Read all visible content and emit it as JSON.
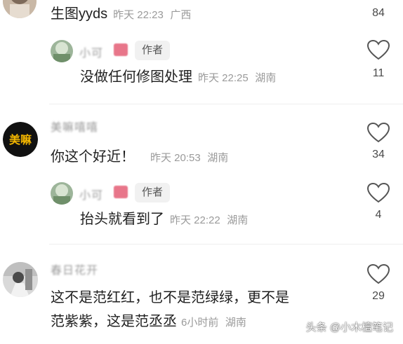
{
  "comments": [
    {
      "text": "生图yyds",
      "time": "昨天 22:23",
      "location": "广西",
      "likes": "84"
    },
    {
      "author_name": "小可",
      "badge": "作者",
      "text": "没做任何修图处理",
      "time": "昨天 22:25",
      "location": "湖南",
      "likes": "11"
    },
    {
      "author_name": "美嘛嘻嘻",
      "avatar_text": "美嘛",
      "text": "你这个好近！",
      "time": "昨天 20:53",
      "location": "湖南",
      "likes": "34"
    },
    {
      "author_name": "小可",
      "badge": "作者",
      "text": "抬头就看到了",
      "time": "昨天 22:22",
      "location": "湖南",
      "likes": "4"
    },
    {
      "author_name": "春日花开",
      "text_line1": "这不是范红红，也不是范绿绿，更不是",
      "text_line2": "范紫紫，这是范丞丞",
      "time": "6小时前",
      "location": "湖南",
      "likes": "29"
    }
  ],
  "watermark": "头条 @小木檀笔记",
  "colors": {
    "meta_gray": "#9a9a9a",
    "text_dark": "#1f1f1f",
    "badge_bg": "#f1f1f1",
    "avatar_black": "#111111",
    "avatar_gold": "#f0b400"
  }
}
